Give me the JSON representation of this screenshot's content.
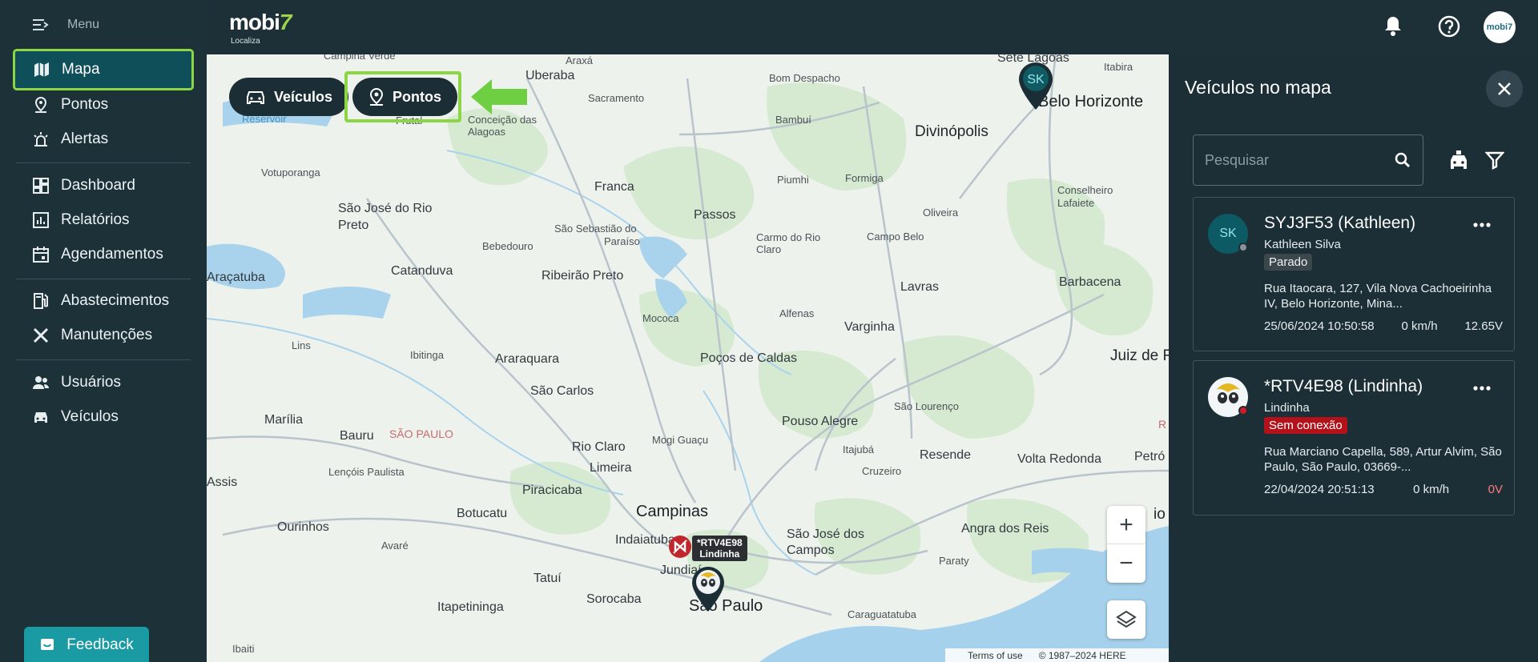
{
  "sidebar": {
    "menu_label": "Menu",
    "items": [
      {
        "label": "Mapa"
      },
      {
        "label": "Pontos"
      },
      {
        "label": "Alertas"
      },
      {
        "label": "Dashboard"
      },
      {
        "label": "Relatórios"
      },
      {
        "label": "Agendamentos"
      },
      {
        "label": "Abastecimentos"
      },
      {
        "label": "Manutenções"
      },
      {
        "label": "Usuários"
      },
      {
        "label": "Veículos"
      }
    ],
    "feedback_label": "Feedback"
  },
  "header": {
    "logo_text": "mobi",
    "logo_number": "7",
    "logo_sub": "Localiza",
    "avatar_text": "mobi7"
  },
  "map": {
    "btn_vehicles": "Veículos",
    "btn_points": "Pontos",
    "zoom_in": "+",
    "zoom_out": "−",
    "terms": "Terms of use",
    "copyright": "© 1987–2024 HERE",
    "cities": [
      "Campina Verde",
      "Araxá",
      "Uberaba",
      "Bom Despacho",
      "Sete Lagoas",
      "Itabira",
      "Sacramento",
      "Belo Horizonte",
      "Frutal",
      "Conceição das",
      "Alagoas",
      "Reservoir",
      "Bambuí",
      "Divinópolis",
      "Votuporanga",
      "Franca",
      "Piumhi",
      "Formiga",
      "Conselheiro",
      "Lafaiete",
      "São José do Rio",
      "Preto",
      "Passos",
      "Oliveira",
      "São Sebastião do",
      "Paraíso",
      "Carmo do Rio",
      "Claro",
      "Campo Belo",
      "Bebedouro",
      "Catanduva",
      "Ribeirão Preto",
      "Lavras",
      "Barbacena",
      "Araçatuba",
      "Mococa",
      "Alfenas",
      "Varginha",
      "Lins",
      "Ibitinga",
      "Araraquara",
      "Poços de Caldas",
      "Juiz de F",
      "São Carlos",
      "São Lourenço",
      "Marília",
      "Bauru",
      "SÃO PAULO",
      "Pouso Alegre",
      "Itajubá",
      "Mogi Guaçu",
      "Rio Claro",
      "Resende",
      "Volta Redonda",
      "Petró",
      "Lençóis Paulista",
      "Limeira",
      "Cruzeiro",
      "Assis",
      "Piracicaba",
      "Botucatu",
      "Campinas",
      "Ourinhos",
      "Indaiatuba",
      "São José dos",
      "Campos",
      "Angra dos Reis",
      "Jundiaí",
      "Paraty",
      "Avaré",
      "Tatuí",
      "Sorocaba",
      "Itapetininga",
      "São Paulo",
      "Caraguatatuba",
      "Ibaiti",
      "R",
      "io"
    ],
    "vehicle_pin_label": "*RTV4E98",
    "vehicle_pin_driver": "Lindinha",
    "sk_pin": "SK"
  },
  "panel": {
    "title": "Veículos no mapa",
    "search_placeholder": "Pesquisar",
    "vehicles": [
      {
        "initials": "SK",
        "title": "SYJ3F53 (Kathleen)",
        "driver": "Kathleen Silva",
        "status": "Parado",
        "address": "Rua Itaocara, 127, Vila Nova Cachoeirinha IV, Belo Horizonte, Mina...",
        "datetime": "25/06/2024 10:50:58",
        "speed": "0 km/h",
        "voltage": "12.65V"
      },
      {
        "initials": "",
        "title": "*RTV4E98 (Lindinha)",
        "driver": "Lindinha",
        "status": "Sem conexão",
        "address": "Rua Marciano Capella, 589, Artur Alvim, São Paulo, São Paulo, 03669-...",
        "datetime": "22/04/2024 20:51:13",
        "speed": "0 km/h",
        "voltage": "0V"
      }
    ]
  },
  "colors": {
    "accent_green": "#8cd645",
    "teal": "#1a9ba3",
    "offline_red": "#b3121a",
    "parked_gray": "#3c474c"
  }
}
